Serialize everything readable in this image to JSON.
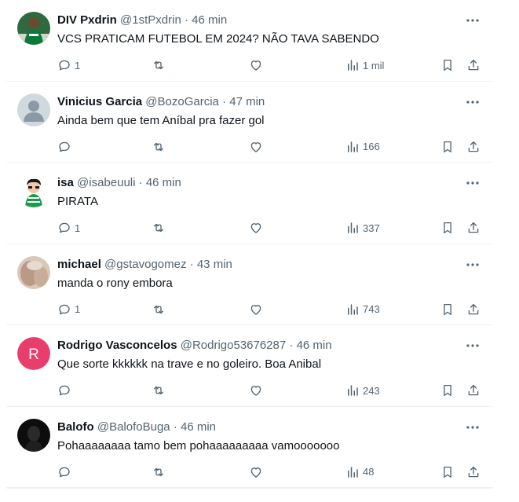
{
  "posts": [
    {
      "name": "DIV Pxdrin",
      "handle": "@1stPxdrin",
      "time": "46 min",
      "text": "VCS PRATICAM FUTEBOL EM 2024? NÃO TAVA SABENDO",
      "replies": "1",
      "views": "1 mil",
      "avatar": "soccer-player"
    },
    {
      "name": "Vinicius Garcia",
      "handle": "@BozoGarcia",
      "time": "47 min",
      "text": "Ainda bem que tem Aníbal pra fazer gol",
      "replies": "",
      "views": "166",
      "avatar": "default"
    },
    {
      "name": "isa",
      "handle": "@isabeuuli",
      "time": "46 min",
      "text": "PIRATA",
      "replies": "1",
      "views": "337",
      "avatar": "cartoon"
    },
    {
      "name": "michael",
      "handle": "@gstavogomez",
      "time": "43 min",
      "text": "manda o rony embora",
      "replies": "1",
      "views": "743",
      "avatar": "photo"
    },
    {
      "name": "Rodrigo Vasconcelos",
      "handle": "@Rodrigo53676287",
      "time": "46 min",
      "text": "Que sorte kkkkkk na trave e no goleiro. Boa Anibal",
      "replies": "",
      "views": "243",
      "avatar": "letter",
      "avatar_letter": "R",
      "avatar_color": "#e83e6c"
    },
    {
      "name": "Balofo",
      "handle": "@BalofoBuga",
      "time": "46 min",
      "text": "Pohaaaaaaaa tamo bem pohaaaaaaaaa vamooooooo",
      "replies": "",
      "views": "48",
      "avatar": "dark"
    }
  ],
  "separator": "·",
  "colors": {
    "text": "#0f1419",
    "secondary": "#536471",
    "border": "#eff3f4"
  },
  "icons": [
    "reply-icon",
    "retweet-icon",
    "like-icon",
    "views-icon",
    "bookmark-icon",
    "share-icon",
    "more-icon"
  ]
}
